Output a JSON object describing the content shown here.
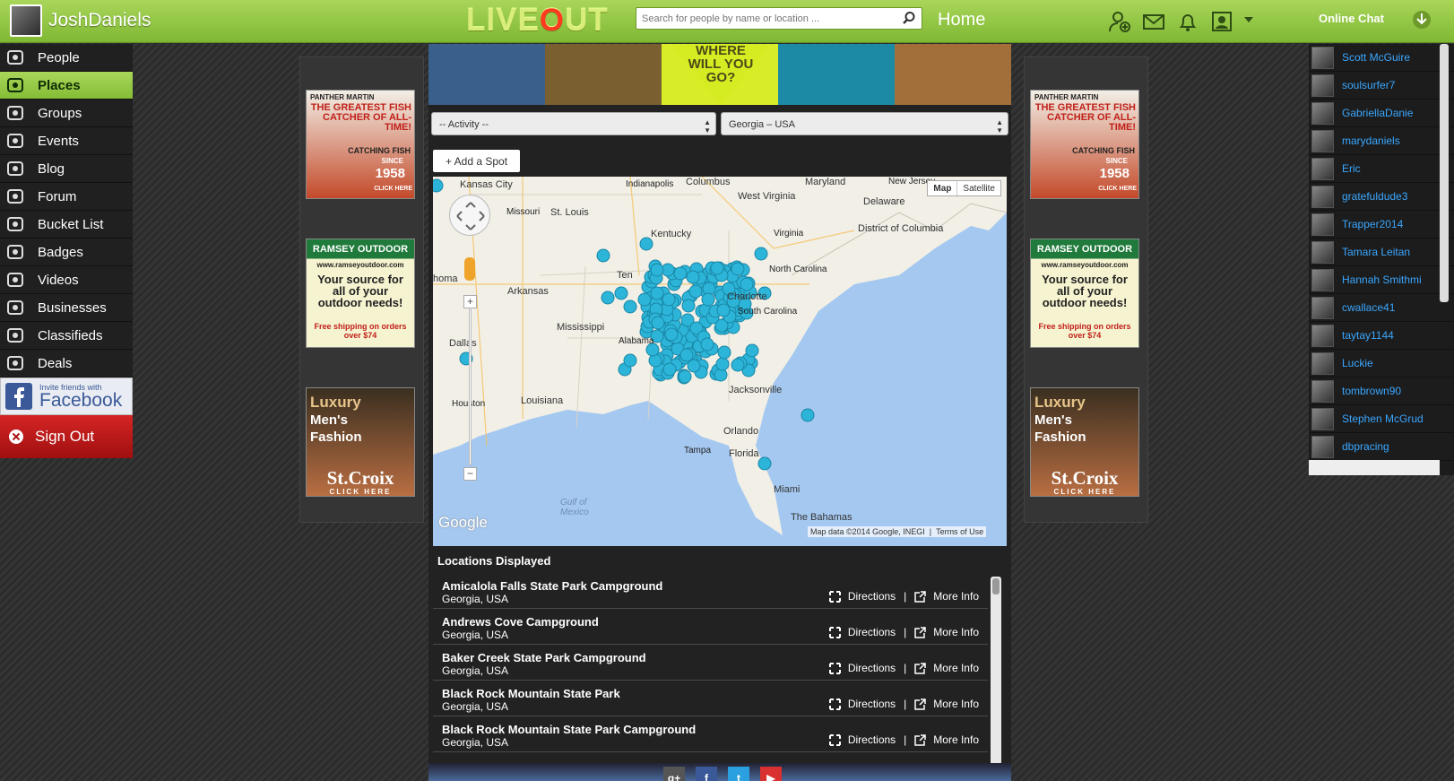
{
  "topbar": {
    "username": "JoshDaniels",
    "logo": {
      "before": "LIVE",
      "o": "O",
      "after": "UT"
    },
    "search_placeholder": "Search for people by name or location ...",
    "home_label": "Home",
    "online_chat_label": "Online Chat",
    "icons": [
      "add-friend-icon",
      "messages-icon",
      "notifications-icon",
      "profile-card-icon",
      "dropdown-caret-icon"
    ],
    "accent_color": "#8cc63f"
  },
  "sidebar": {
    "items": [
      {
        "label": "People",
        "icon": "people-icon"
      },
      {
        "label": "Places",
        "icon": "places-icon",
        "active": true
      },
      {
        "label": "Groups",
        "icon": "groups-icon"
      },
      {
        "label": "Events",
        "icon": "calendar-icon"
      },
      {
        "label": "Blog",
        "icon": "blog-icon"
      },
      {
        "label": "Forum",
        "icon": "forum-icon"
      },
      {
        "label": "Bucket List",
        "icon": "bucket-list-icon"
      },
      {
        "label": "Badges",
        "icon": "badges-icon"
      },
      {
        "label": "Videos",
        "icon": "videos-icon"
      },
      {
        "label": "Businesses",
        "icon": "businesses-icon"
      },
      {
        "label": "Classifieds",
        "icon": "classifieds-icon"
      },
      {
        "label": "Deals",
        "icon": "deals-icon"
      }
    ],
    "facebook_small": "Invite friends with",
    "facebook_big": "Facebook",
    "sign_out": "Sign Out"
  },
  "ads": {
    "ad1": {
      "top": "PANTHER MARTIN",
      "title": "THE GREATEST FISH CATCHER OF ALL-TIME!",
      "sub": "CATCHING FISH",
      "since": "SINCE",
      "year": "1958",
      "cta": "CLICK HERE"
    },
    "ad2": {
      "brand": "RAMSEY OUTDOOR",
      "url": "www.ramseyoutdoor.com",
      "tagline": "Your source for all of your outdoor needs!",
      "shipping": "Free shipping on orders over $74"
    },
    "ad3": {
      "title1": "Luxury",
      "title2": "Men's",
      "title3": "Fashion",
      "brand": "St.Croix",
      "cta": "CLICK HERE"
    }
  },
  "main": {
    "hero_text": "WHERE WILL YOU GO?",
    "activity_select": "-- Activity --",
    "location_select": "Georgia – USA",
    "add_spot": "+ Add a Spot",
    "map_type": {
      "map": "Map",
      "satellite": "Satellite"
    },
    "map_labels": [
      "Kansas City",
      "Indianapolis",
      "Columbus",
      "Maryland",
      "New Jersey",
      "Delaware",
      "West Virginia",
      "Missouri",
      "St. Louis",
      "Kentucky",
      "Virginia",
      "District of Columbia",
      "Ten",
      "North Carolina",
      "Arkansas",
      "Charlotte",
      "South Carolina",
      "homa",
      "Mississippi",
      "Alabama",
      "Dallas",
      "Louisiana",
      "Houston",
      "Jacksonville",
      "Orlando",
      "Tampa",
      "Florida",
      "Miami",
      "Gulf of Mexico",
      "The Bahamas"
    ],
    "google_logo": "Google",
    "map_credit": "Map data ©2014 Google, INEGI",
    "terms": "Terms of Use",
    "locations_header": "Locations Displayed",
    "locations": [
      {
        "name": "Amicalola Falls State Park Campground",
        "place": "Georgia, USA"
      },
      {
        "name": "Andrews Cove Campground",
        "place": "Georgia, USA"
      },
      {
        "name": "Baker Creek State Park Campground",
        "place": "Georgia, USA"
      },
      {
        "name": "Black Rock Mountain State Park",
        "place": "Georgia, USA"
      },
      {
        "name": "Black Rock Mountain State Park Campground",
        "place": "Georgia, USA"
      }
    ],
    "directions_label": "Directions",
    "more_info_label": "More Info",
    "separator": "|",
    "social": [
      {
        "icon": "google-plus-icon",
        "label": "g+",
        "color": "#555555"
      },
      {
        "icon": "facebook-icon",
        "label": "f",
        "color": "#3b5998"
      },
      {
        "icon": "twitter-icon",
        "label": "t",
        "color": "#2ba0e0"
      },
      {
        "icon": "youtube-icon",
        "label": "▶",
        "color": "#d93030"
      }
    ]
  },
  "chat": {
    "users": [
      "Scott McGuire",
      "soulsurfer7",
      "GabriellaDanie",
      "marydaniels",
      "Eric",
      "gratefuldude3",
      "Trapper2014",
      "Tamara Leitan",
      "Hannah Smithmi",
      "cwallace41",
      "taytay1144",
      "Luckie",
      "tombrown90",
      "Stephen McGrud",
      "dbpracing"
    ],
    "name_color": "#3aa7ff"
  }
}
